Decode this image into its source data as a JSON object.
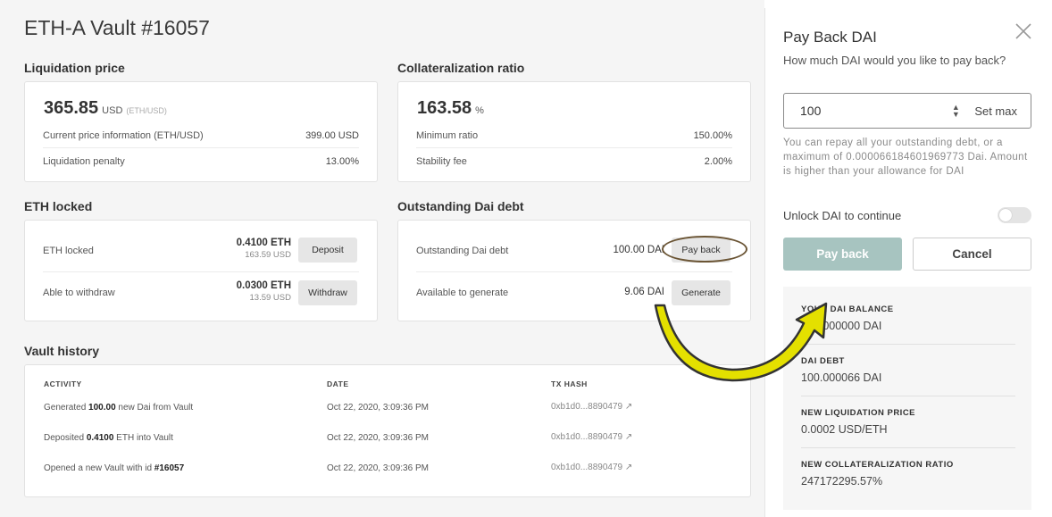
{
  "vault": {
    "title": "ETH-A Vault #16057",
    "liquidation": {
      "heading": "Liquidation price",
      "value": "365.85",
      "unit": "USD",
      "subunit": "(ETH/USD)",
      "rows": [
        {
          "label": "Current price information (ETH/USD)",
          "value": "399.00 USD"
        },
        {
          "label": "Liquidation penalty",
          "value": "13.00%"
        }
      ]
    },
    "collateral": {
      "heading": "Collateralization ratio",
      "value": "163.58",
      "unit": "%",
      "rows": [
        {
          "label": "Minimum ratio",
          "value": "150.00%"
        },
        {
          "label": "Stability fee",
          "value": "2.00%"
        }
      ]
    },
    "eth_locked": {
      "heading": "ETH locked",
      "rows": [
        {
          "label": "ETH locked",
          "amount": "0.4100 ETH",
          "sub": "163.59 USD",
          "button": "Deposit"
        },
        {
          "label": "Able to withdraw",
          "amount": "0.0300 ETH",
          "sub": "13.59 USD",
          "button": "Withdraw"
        }
      ]
    },
    "debt": {
      "heading": "Outstanding Dai debt",
      "rows": [
        {
          "label": "Outstanding Dai debt",
          "amount": "100.00 DAI",
          "button": "Pay back"
        },
        {
          "label": "Available to generate",
          "amount": "9.06 DAI",
          "button": "Generate"
        }
      ]
    },
    "history": {
      "heading": "Vault history",
      "columns": [
        "ACTIVITY",
        "DATE",
        "TX HASH"
      ],
      "rows": [
        {
          "pre": "Generated ",
          "bold": "100.00",
          "post": " new Dai from Vault",
          "date": "Oct 22, 2020, 3:09:36 PM",
          "tx": "0xb1d0...8890479 ↗"
        },
        {
          "pre": "Deposited ",
          "bold": "0.4100",
          "post": " ETH into Vault",
          "date": "Oct 22, 2020, 3:09:36 PM",
          "tx": "0xb1d0...8890479 ↗"
        },
        {
          "pre": "Opened a new Vault with id ",
          "bold": "#16057",
          "post": "",
          "date": "Oct 22, 2020, 3:09:36 PM",
          "tx": "0xb1d0...8890479 ↗"
        }
      ]
    }
  },
  "drawer": {
    "title": "Pay Back DAI",
    "question": "How much DAI would you like to pay back?",
    "input_value": "100",
    "set_max": "Set max",
    "note": "You can repay all your outstanding debt, or a maximum of 0.000066184601969773 Dai. Amount is higher than your allowance for DAI",
    "unlock_label": "Unlock DAI to continue",
    "pay_back": "Pay back",
    "cancel": "Cancel",
    "summary": [
      {
        "label": "YOUR DAI BALANCE",
        "value": "100.000000 DAI"
      },
      {
        "label": "DAI DEBT",
        "value": "100.000066 DAI"
      },
      {
        "label": "NEW LIQUIDATION PRICE",
        "value": "0.0002 USD/ETH"
      },
      {
        "label": "NEW COLLATERALIZATION RATIO",
        "value": "247172295.57%"
      }
    ]
  },
  "colors": {
    "accent": "#a7c4c0",
    "arrow_fill": "#e4e000",
    "annotation": "#6b5535"
  },
  "icons": [
    "close-icon",
    "spinner-icon",
    "external-link-icon",
    "arrow-annotation-icon"
  ]
}
